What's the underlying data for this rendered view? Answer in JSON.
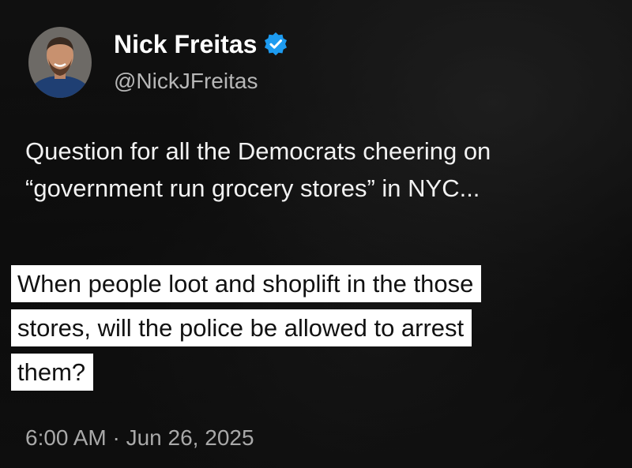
{
  "tweet": {
    "author": {
      "display_name": "Nick Freitas",
      "handle": "@NickJFreitas",
      "verified": true,
      "avatar_icon": "person-avatar",
      "verified_icon": "verified-badge-icon"
    },
    "body_lines": [
      "Question for all the Democrats cheering on",
      "“government run grocery stores” in NYC..."
    ],
    "highlighted_lines": [
      "When people loot and shoplift in the those",
      "stores, will the police be allowed to arrest",
      "them?"
    ],
    "timestamp": "6:00 AM · Jun 26, 2025"
  },
  "colors": {
    "verified_badge": "#1d9bf0",
    "text_primary": "#ffffff",
    "text_secondary": "#b7b7b7",
    "highlight_bg": "#ffffff",
    "highlight_text": "#111111"
  }
}
